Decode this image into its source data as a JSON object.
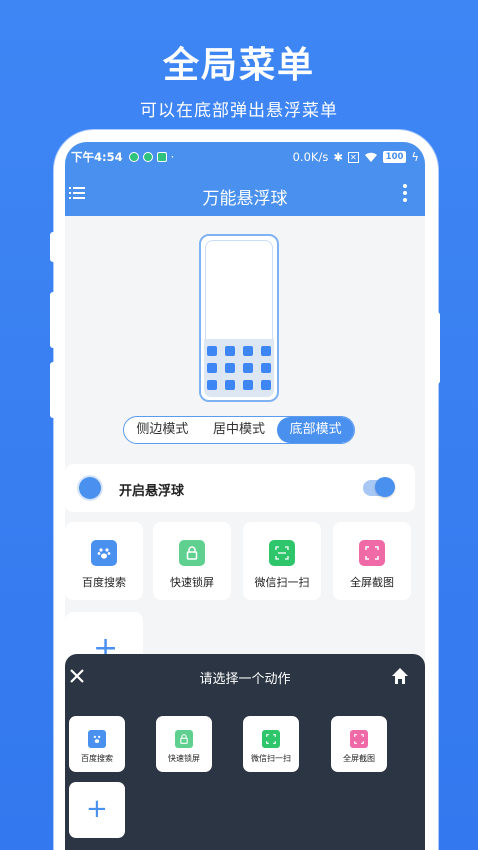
{
  "promo": {
    "title": "全局菜单",
    "subtitle": "可以在底部弹出悬浮菜单"
  },
  "statusbar": {
    "time": "下午4:54",
    "speed": "0.0K/s",
    "battery": "100"
  },
  "appbar": {
    "title": "万能悬浮球"
  },
  "mode_switch": {
    "options": [
      "侧边模式",
      "居中模式",
      "底部模式"
    ],
    "selected": "底部模式"
  },
  "toggle": {
    "label": "开启悬浮球",
    "on": true
  },
  "actions": [
    {
      "label": "百度搜索",
      "icon": "baidu-paw-icon",
      "color": "#4a90ee"
    },
    {
      "label": "快速锁屏",
      "icon": "lock-icon",
      "color": "#5fd08f"
    },
    {
      "label": "微信扫一扫",
      "icon": "scan-icon",
      "color": "#2ec56b"
    },
    {
      "label": "全屏截图",
      "icon": "screenshot-icon",
      "color": "#f06aa8"
    }
  ],
  "sheet": {
    "title": "请选择一个动作",
    "items": [
      {
        "label": "百度搜索",
        "icon": "baidu-paw-icon"
      },
      {
        "label": "快速锁屏",
        "icon": "lock-icon"
      },
      {
        "label": "微信扫一扫",
        "icon": "scan-icon"
      },
      {
        "label": "全屏截图",
        "icon": "screenshot-icon"
      }
    ]
  },
  "colors": {
    "accent": "#4a90ee",
    "background": "#3f86f5",
    "sheet": "#2b3543"
  }
}
